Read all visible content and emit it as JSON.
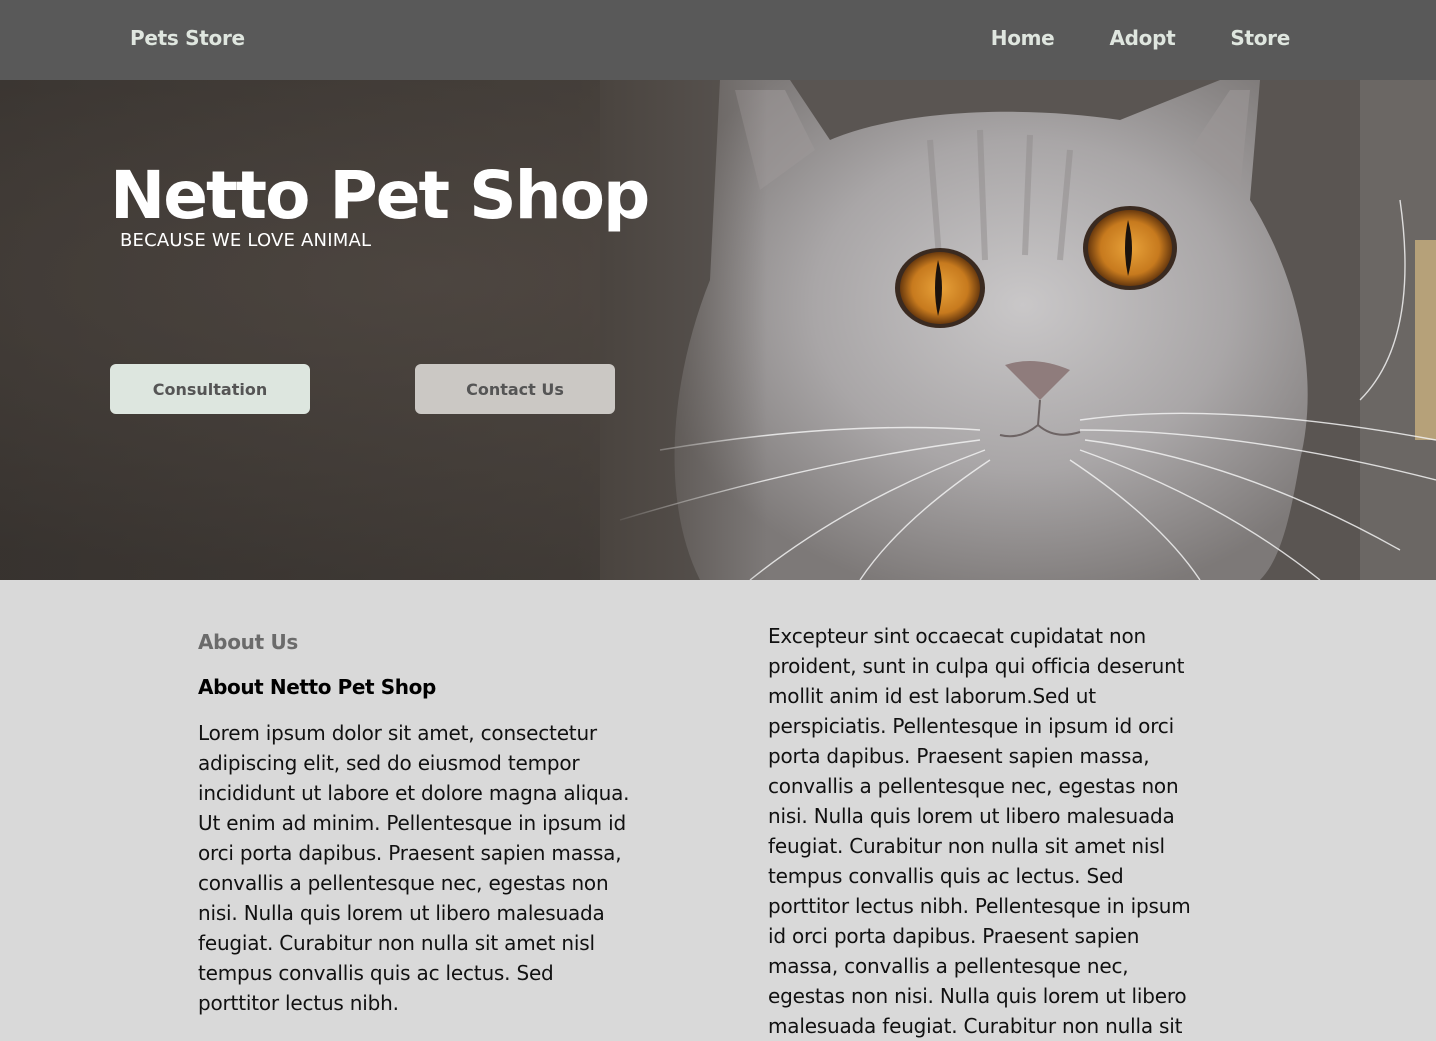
{
  "nav": {
    "brand": "Pets Store",
    "links": [
      "Home",
      "Adopt",
      "Store"
    ]
  },
  "hero": {
    "title": "Netto Pet Shop",
    "subtitle": "BECAUSE WE LOVE ANIMAL",
    "buttons": {
      "consultation": "Consultation",
      "contact": "Contact Us"
    },
    "image_icon": "cat-photo"
  },
  "about": {
    "label": "About Us",
    "heading": "About Netto Pet Shop",
    "left_text": "Lorem ipsum dolor sit amet, consectetur adipiscing elit, sed do eiusmod tempor incididunt ut labore et dolore magna aliqua. Ut enim ad minim. Pellentesque in ipsum id orci porta dapibus. Praesent sapien massa, convallis a pellentesque nec, egestas non nisi. Nulla quis lorem ut libero malesuada feugiat. Curabitur non nulla sit amet nisl tempus convallis quis ac lectus. Sed porttitor lectus nibh.",
    "right_text": "Excepteur sint occaecat cupidatat non proident, sunt in culpa qui officia deserunt mollit anim id est laborum.Sed ut perspiciatis. Pellentesque in ipsum id orci porta dapibus. Praesent sapien massa, convallis a pellentesque nec, egestas non nisi. Nulla quis lorem ut libero malesuada feugiat. Curabitur non nulla sit amet nisl tempus convallis quis ac lectus. Sed porttitor lectus nibh. Pellentesque in ipsum id orci porta dapibus. Praesent sapien massa, convallis a pellentesque nec, egestas non nisi. Nulla quis lorem ut libero malesuada feugiat. Curabitur non nulla sit"
  },
  "colors": {
    "navbar": "#595959",
    "page_bg": "#d9d9d9",
    "consult_btn": "#dde6df",
    "contact_btn": "#cbc8c4"
  }
}
